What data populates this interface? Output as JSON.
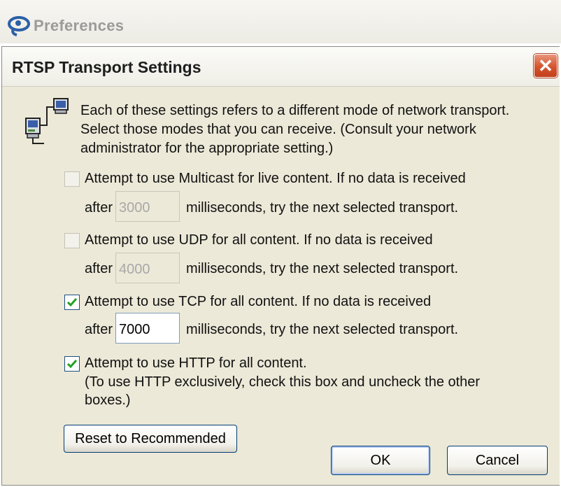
{
  "parent_window": {
    "title": "Preferences"
  },
  "dialog": {
    "title": "RTSP Transport Settings",
    "close_glyph": "✕",
    "intro": "Each of these settings refers to a different mode of network transport. Select those modes that you can receive. (Consult your network administrator for the appropriate setting.)",
    "icons": {
      "app": "realplayer-logo-icon",
      "network": "network-computers-icon",
      "close": "close-icon",
      "check": "checkmark-icon"
    },
    "options": [
      {
        "label": "Attempt to use Multicast for live content.  If no data is received",
        "checked": false,
        "enabled": false,
        "after_label": "after",
        "value": "3000",
        "suffix": "milliseconds, try the next selected transport."
      },
      {
        "label": "Attempt to use UDP for all content.  If no data is received",
        "checked": false,
        "enabled": false,
        "after_label": "after",
        "value": "4000",
        "suffix": "milliseconds, try the next selected transport."
      },
      {
        "label": "Attempt to use TCP for all content.  If no data is received",
        "checked": true,
        "enabled": true,
        "after_label": "after",
        "value": "7000",
        "suffix": "milliseconds, try the next selected transport."
      },
      {
        "label": "Attempt to use HTTP for all content.",
        "checked": true,
        "enabled": true,
        "note_line1": "(To use HTTP exclusively, check this box and uncheck the other",
        "note_line2": "boxes.)"
      }
    ],
    "buttons": {
      "reset": "Reset to Recommended",
      "ok": "OK",
      "cancel": "Cancel"
    }
  }
}
